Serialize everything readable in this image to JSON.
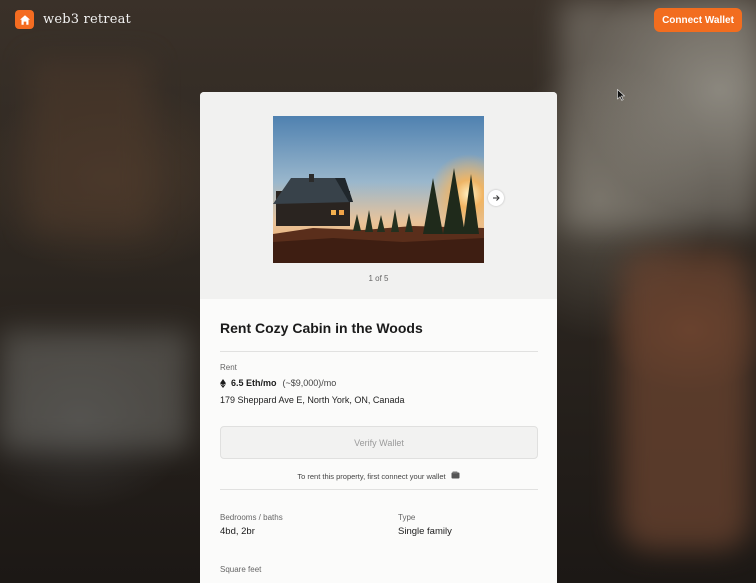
{
  "app": {
    "name": "web3 retreat",
    "logo_icon": "home-icon"
  },
  "header": {
    "connect_label": "Connect Wallet"
  },
  "colors": {
    "accent": "#f26d1f",
    "card": "#fbfbfa"
  },
  "listing": {
    "carousel": {
      "counter": "1 of 5",
      "next_icon": "arrow-right-icon"
    },
    "title": "Rent Cozy Cabin in the Woods",
    "rent_label": "Rent",
    "price": "6.5 Eth/mo",
    "usd": "(~$9,000)/mo",
    "address": "179 Sheppard Ave E, North York, ON, Canada",
    "verify_label": "Verify Wallet",
    "hint": "To rent this property, first connect your wallet",
    "fields": {
      "bedrooms_label": "Bedrooms / baths",
      "bedrooms_value": "4bd, 2br",
      "type_label": "Type",
      "type_value": "Single family",
      "sqft_label": "Square feet"
    }
  }
}
